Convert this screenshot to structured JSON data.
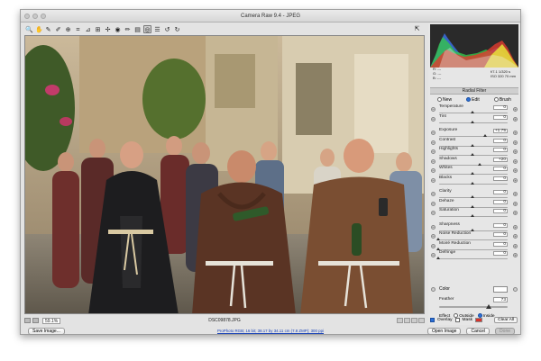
{
  "window": {
    "title": "Camera Raw 9.4  -  JPEG"
  },
  "toolbar": {
    "tools": [
      {
        "icon": "zoom-icon",
        "glyph": "🔍"
      },
      {
        "icon": "hand-icon",
        "glyph": "✋"
      },
      {
        "icon": "white-balance-icon",
        "glyph": "✎"
      },
      {
        "icon": "color-sampler-icon",
        "glyph": "✐"
      },
      {
        "icon": "targeted-adjustment-icon",
        "glyph": "⊕"
      },
      {
        "icon": "crop-icon",
        "glyph": "⌗"
      },
      {
        "icon": "straighten-icon",
        "glyph": "⊿"
      },
      {
        "icon": "transform-icon",
        "glyph": "⊞"
      },
      {
        "icon": "spot-removal-icon",
        "glyph": "✢"
      },
      {
        "icon": "red-eye-icon",
        "glyph": "◉"
      },
      {
        "icon": "adjustment-brush-icon",
        "glyph": "✏"
      },
      {
        "icon": "graduated-filter-icon",
        "glyph": "▤"
      },
      {
        "icon": "radial-filter-icon",
        "glyph": "◎"
      },
      {
        "icon": "preferences-icon",
        "glyph": "☰"
      },
      {
        "icon": "rotate-left-icon",
        "glyph": "↺"
      },
      {
        "icon": "rotate-right-icon",
        "glyph": "↻"
      }
    ],
    "active_index": 12,
    "fullscreen_icon": "⇱"
  },
  "bottom_bar": {
    "zoom": "59.1%",
    "filename": "DSC09878.JPG"
  },
  "histogram": {
    "colors": {
      "red": "#e23b2e",
      "green": "#34c44a",
      "blue": "#3a6de0",
      "yellow": "#e8e23a",
      "white": "#f2f2f2"
    }
  },
  "readout": {
    "r": "R:",
    "g": "G:",
    "b": "B:",
    "r_val": "---",
    "g_val": "---",
    "b_val": "---",
    "exposure": "f/7.1   1/320 s",
    "iso": "ISO 320   70 mm"
  },
  "panel": {
    "title": "Radial Filter",
    "modes": [
      "New",
      "Edit",
      "Brush"
    ],
    "active_mode": 1,
    "sliders": [
      {
        "label": "Temperature",
        "value": "0",
        "pos": 0.5
      },
      {
        "label": "Tint",
        "value": "0",
        "pos": 0.5
      },
      {
        "gap": true
      },
      {
        "label": "Exposure",
        "value": "+1.75",
        "pos": 0.69
      },
      {
        "label": "Contrast",
        "value": "0",
        "pos": 0.5
      },
      {
        "label": "Highlights",
        "value": "0",
        "pos": 0.5
      },
      {
        "label": "Shadows",
        "value": "+20",
        "pos": 0.6
      },
      {
        "label": "Whites",
        "value": "0",
        "pos": 0.5
      },
      {
        "label": "Blacks",
        "value": "0",
        "pos": 0.5
      },
      {
        "gap": true
      },
      {
        "label": "Clarity",
        "value": "0",
        "pos": 0.5
      },
      {
        "label": "Dehaze",
        "value": "0",
        "pos": 0.5
      },
      {
        "label": "Saturation",
        "value": "0",
        "pos": 0.5
      },
      {
        "gap": true
      },
      {
        "label": "Sharpness",
        "value": "0",
        "pos": 0.5
      },
      {
        "label": "Noise Reduction",
        "value": "0",
        "pos": 0.0
      },
      {
        "label": "Moiré Reduction",
        "value": "0",
        "pos": 0.0
      },
      {
        "label": "Defringe",
        "value": "0",
        "pos": 0.0
      }
    ],
    "color_label": "Color",
    "feather_label": "Feather",
    "feather_value": "73",
    "feather_pos": 0.73,
    "effect_label": "Effect",
    "effect_options": [
      "Outside",
      "Inside"
    ],
    "effect_selected": 1,
    "overlay_label": "Overlay",
    "mask_label": "Mask",
    "clear_all": "Clear All"
  },
  "footer": {
    "save_image": "Save Image...",
    "workflow": "ProPhoto RGB; 16 bit; 38.17 by 34.11 cm (7.8 ZMP); 300 ppi",
    "open_image": "Open Image",
    "cancel": "Cancel",
    "done": "Done"
  }
}
